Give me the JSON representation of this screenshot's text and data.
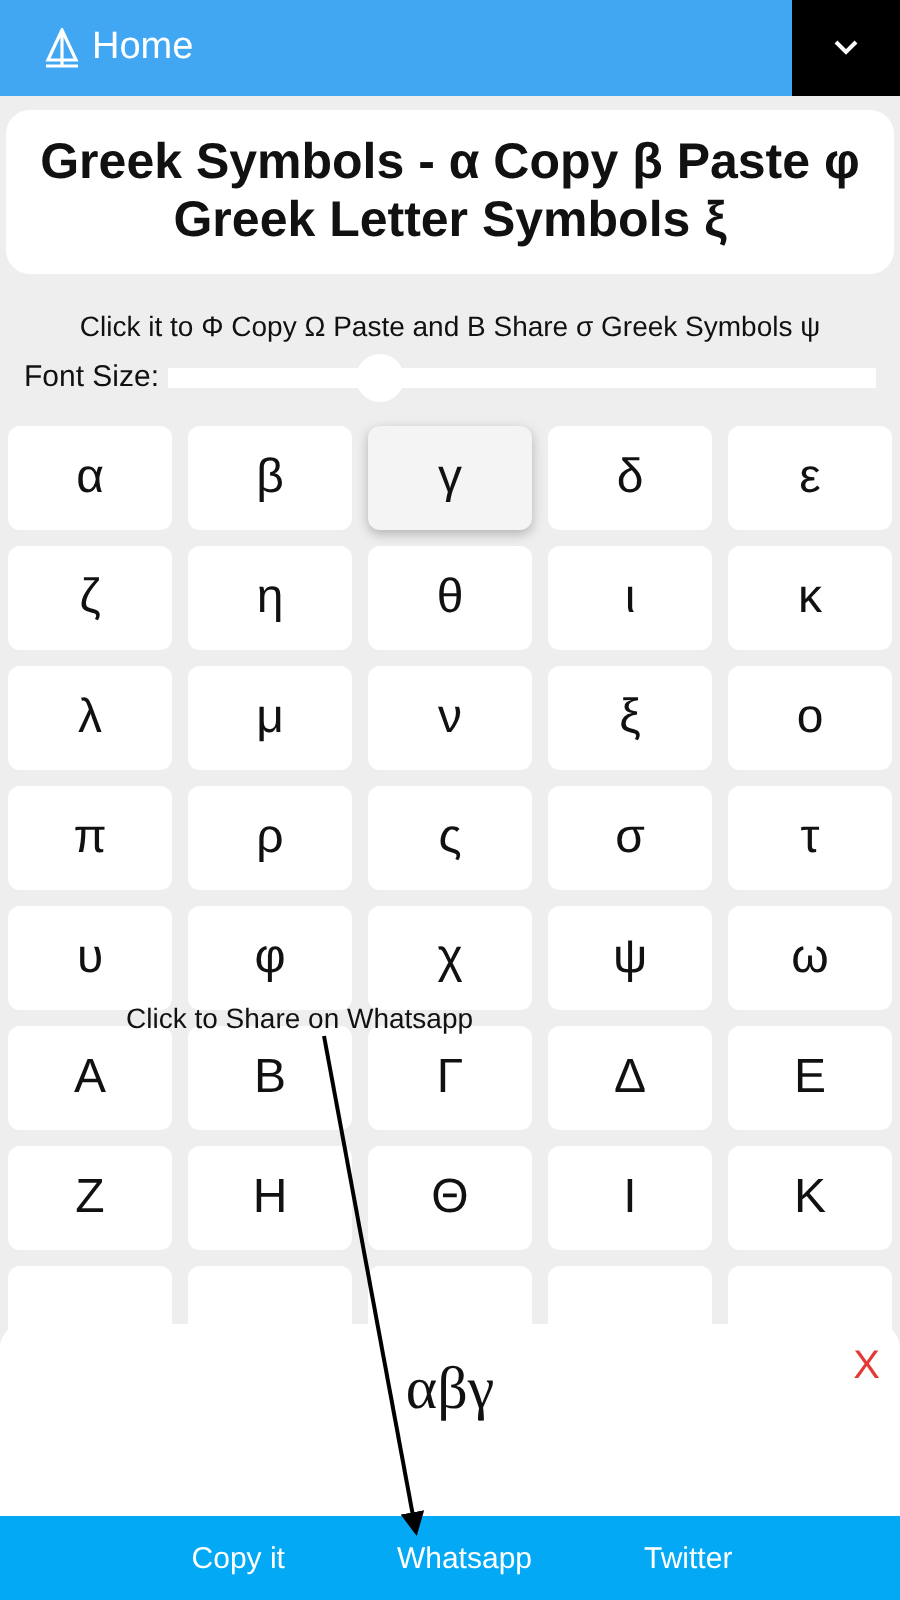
{
  "nav": {
    "home": "Home"
  },
  "title": "Greek Symbols - α Copy β Paste φ Greek Letter Symbols ξ",
  "subtitle": "Click it to Φ Copy Ω Paste and Β Share σ Greek Symbols ψ",
  "font_size": {
    "label": "Font Size:",
    "level": 0.3
  },
  "symbols": [
    {
      "char": "α",
      "selected": false
    },
    {
      "char": "β",
      "selected": false
    },
    {
      "char": "γ",
      "selected": true
    },
    {
      "char": "δ",
      "selected": false
    },
    {
      "char": "ε",
      "selected": false
    },
    {
      "char": "ζ",
      "selected": false
    },
    {
      "char": "η",
      "selected": false
    },
    {
      "char": "θ",
      "selected": false
    },
    {
      "char": "ι",
      "selected": false
    },
    {
      "char": "κ",
      "selected": false
    },
    {
      "char": "λ",
      "selected": false
    },
    {
      "char": "μ",
      "selected": false
    },
    {
      "char": "ν",
      "selected": false
    },
    {
      "char": "ξ",
      "selected": false
    },
    {
      "char": "ο",
      "selected": false
    },
    {
      "char": "π",
      "selected": false
    },
    {
      "char": "ρ",
      "selected": false
    },
    {
      "char": "ς",
      "selected": false
    },
    {
      "char": "σ",
      "selected": false
    },
    {
      "char": "τ",
      "selected": false
    },
    {
      "char": "υ",
      "selected": false
    },
    {
      "char": "φ",
      "selected": false
    },
    {
      "char": "χ",
      "selected": false
    },
    {
      "char": "ψ",
      "selected": false
    },
    {
      "char": "ω",
      "selected": false
    },
    {
      "char": "Α",
      "selected": false
    },
    {
      "char": "Β",
      "selected": false
    },
    {
      "char": "Γ",
      "selected": false
    },
    {
      "char": "Δ",
      "selected": false
    },
    {
      "char": "Ε",
      "selected": false
    },
    {
      "char": "Ζ",
      "selected": false
    },
    {
      "char": "Η",
      "selected": false
    },
    {
      "char": "Θ",
      "selected": false
    },
    {
      "char": "Ι",
      "selected": false
    },
    {
      "char": "Κ",
      "selected": false
    },
    {
      "selected": false
    },
    {
      "selected": false
    },
    {
      "selected": false
    },
    {
      "selected": false
    },
    {
      "selected": false
    }
  ],
  "annotation": "Click to Share on Whatsapp",
  "panel": {
    "value": "αβγ",
    "close": "X",
    "buttons": [
      "Copy it",
      "Whatsapp",
      "Twitter"
    ]
  }
}
